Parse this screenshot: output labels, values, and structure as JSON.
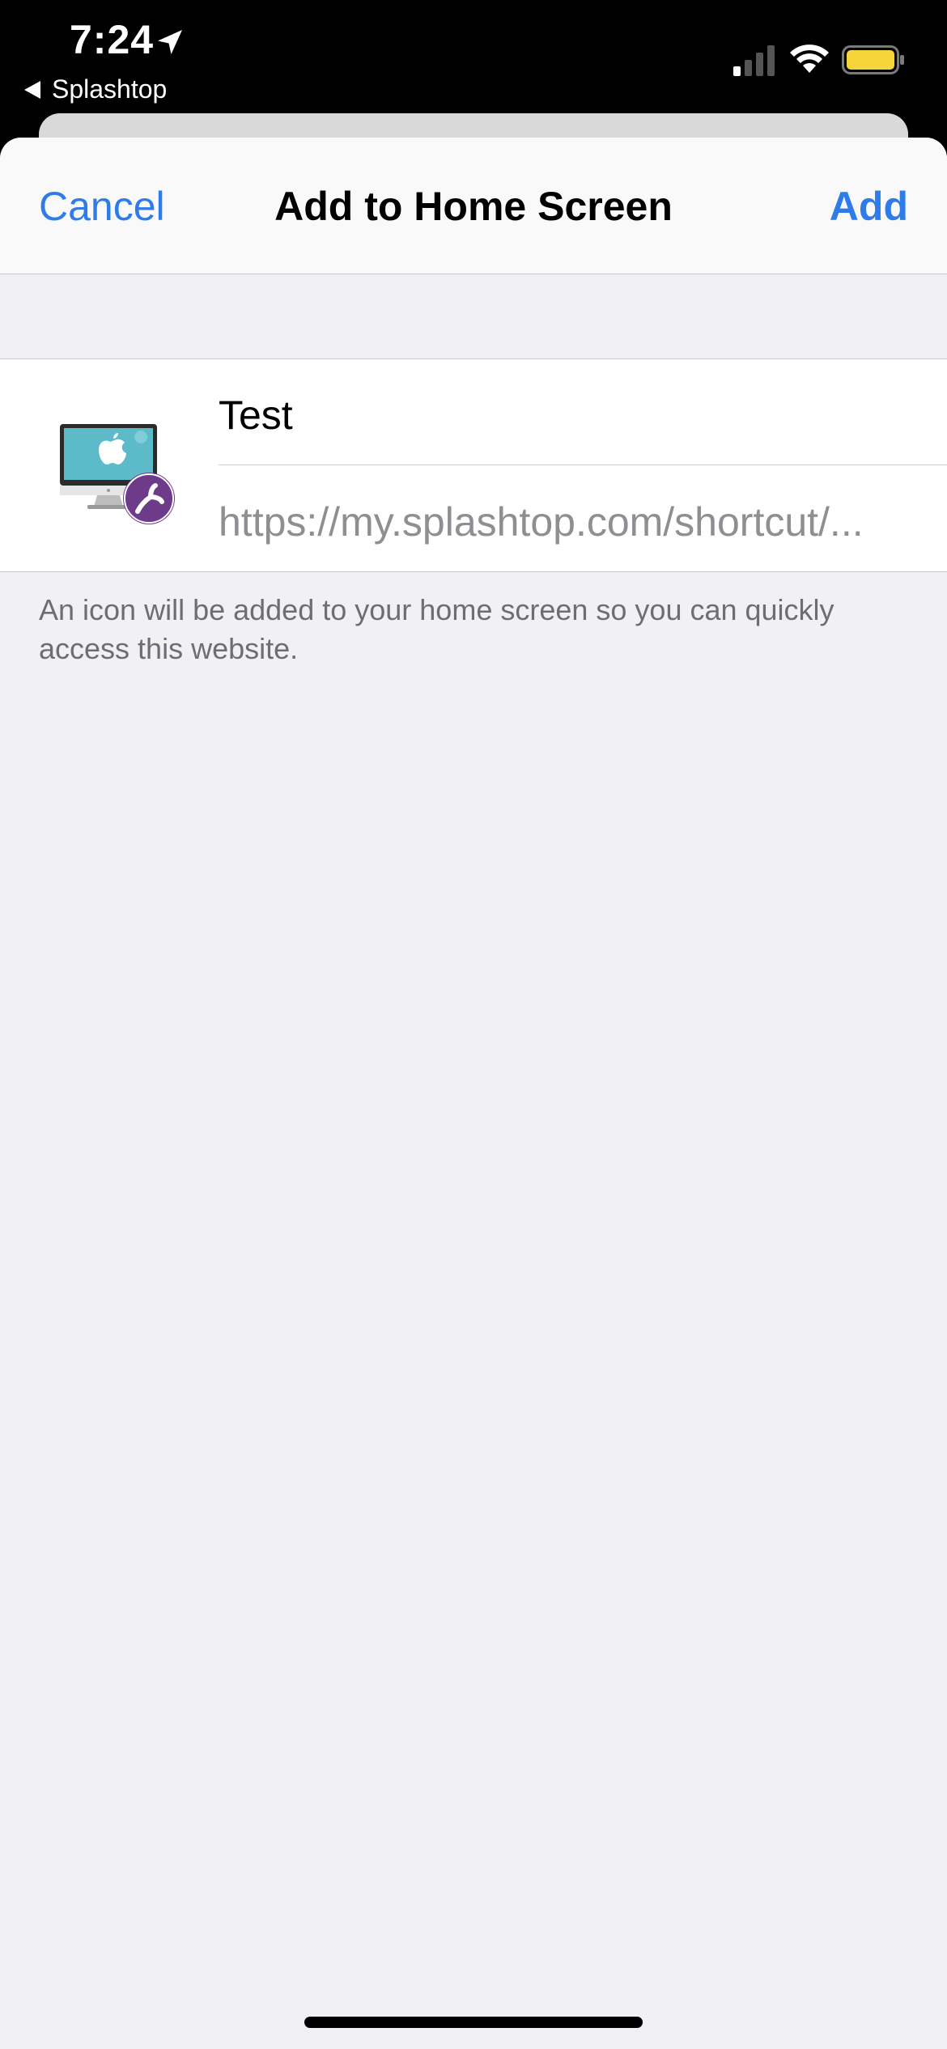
{
  "status_bar": {
    "time": "7:24",
    "back_app_label": "Splashtop"
  },
  "nav": {
    "cancel_label": "Cancel",
    "title": "Add to Home Screen",
    "add_label": "Add"
  },
  "bookmark": {
    "name": "Test",
    "url": "https://my.splashtop.com/shortcut/..."
  },
  "footnote": "An icon will be added to your home screen so you can quickly access this website.",
  "colors": {
    "accent": "#2f7ce9",
    "badge": "#6e3b8a",
    "battery": "#f5d43a"
  }
}
